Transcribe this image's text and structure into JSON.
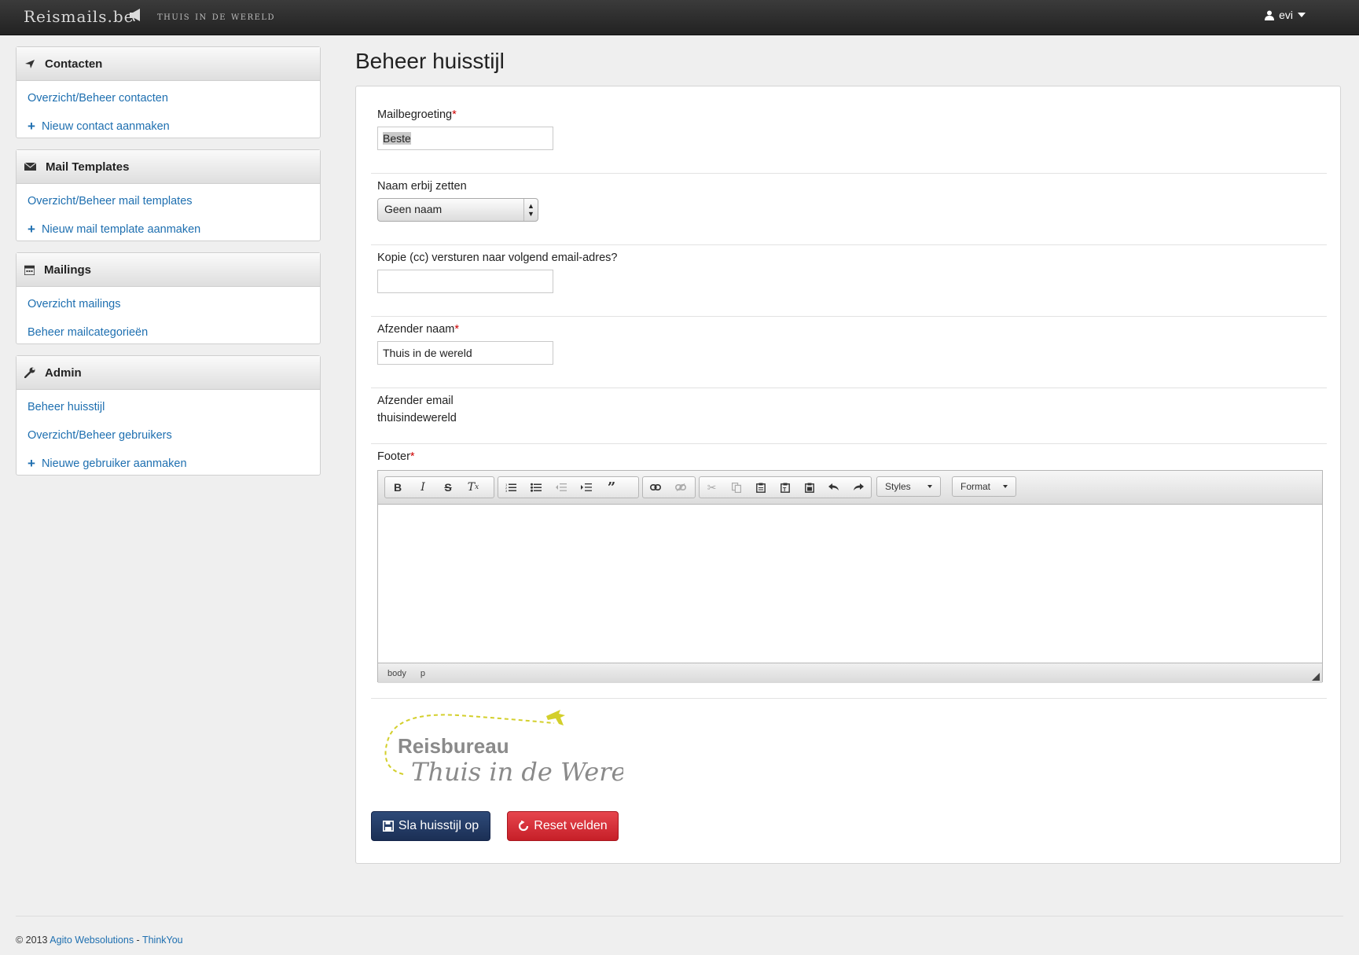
{
  "navbar": {
    "brand": "Reismails.be",
    "subtitle": "Thuis in de wereld",
    "user": "evi"
  },
  "sidebar": {
    "panels": [
      {
        "title": "Contacten",
        "icon": "plane-icon",
        "items": [
          {
            "label": "Overzicht/Beheer contacten",
            "plus": false
          },
          {
            "label": "Nieuw contact aanmaken",
            "plus": true
          }
        ]
      },
      {
        "title": "Mail Templates",
        "icon": "envelope-icon",
        "items": [
          {
            "label": "Overzicht/Beheer mail templates",
            "plus": false
          },
          {
            "label": "Nieuw mail template aanmaken",
            "plus": true
          }
        ]
      },
      {
        "title": "Mailings",
        "icon": "calendar-icon",
        "items": [
          {
            "label": "Overzicht mailings",
            "plus": false
          },
          {
            "label": "Beheer mailcategorieën",
            "plus": false
          }
        ]
      },
      {
        "title": "Admin",
        "icon": "wrench-icon",
        "items": [
          {
            "label": "Beheer huisstijl",
            "plus": false
          },
          {
            "label": "Overzicht/Beheer gebruikers",
            "plus": false
          },
          {
            "label": "Nieuwe gebruiker aanmaken",
            "plus": true
          }
        ]
      }
    ]
  },
  "main": {
    "title": "Beheer huisstijl",
    "fields": {
      "greeting": {
        "label": "Mailbegroeting",
        "value": "Beste"
      },
      "name_option": {
        "label": "Naam erbij zetten",
        "value": "Geen naam"
      },
      "cc": {
        "label": "Kopie (cc) versturen naar volgend email-adres?",
        "value": ""
      },
      "sender_name": {
        "label": "Afzender naam",
        "value": "Thuis in de wereld"
      },
      "sender_email": {
        "label": "Afzender email",
        "value": "thuisindewereld"
      },
      "footer": {
        "label": "Footer"
      }
    },
    "required_mark": "*",
    "editor": {
      "styles_label": "Styles",
      "format_label": "Format",
      "path": [
        "body",
        "p"
      ]
    },
    "logo": {
      "line1": "Reisbureau",
      "line2": "Thuis in de Wereld",
      "accent_color": "#d3cf2b"
    },
    "buttons": {
      "save": "Sla huisstijl op",
      "reset": "Reset velden"
    }
  },
  "footer": {
    "copyright": "© 2013",
    "link1": "Agito Websolutions",
    "separator": " - ",
    "link2": "ThinkYou"
  },
  "colors": {
    "link": "#1e6fb0",
    "save": "#1b2f55",
    "reset": "#c61f28",
    "navbar": "#2a2a2a"
  }
}
